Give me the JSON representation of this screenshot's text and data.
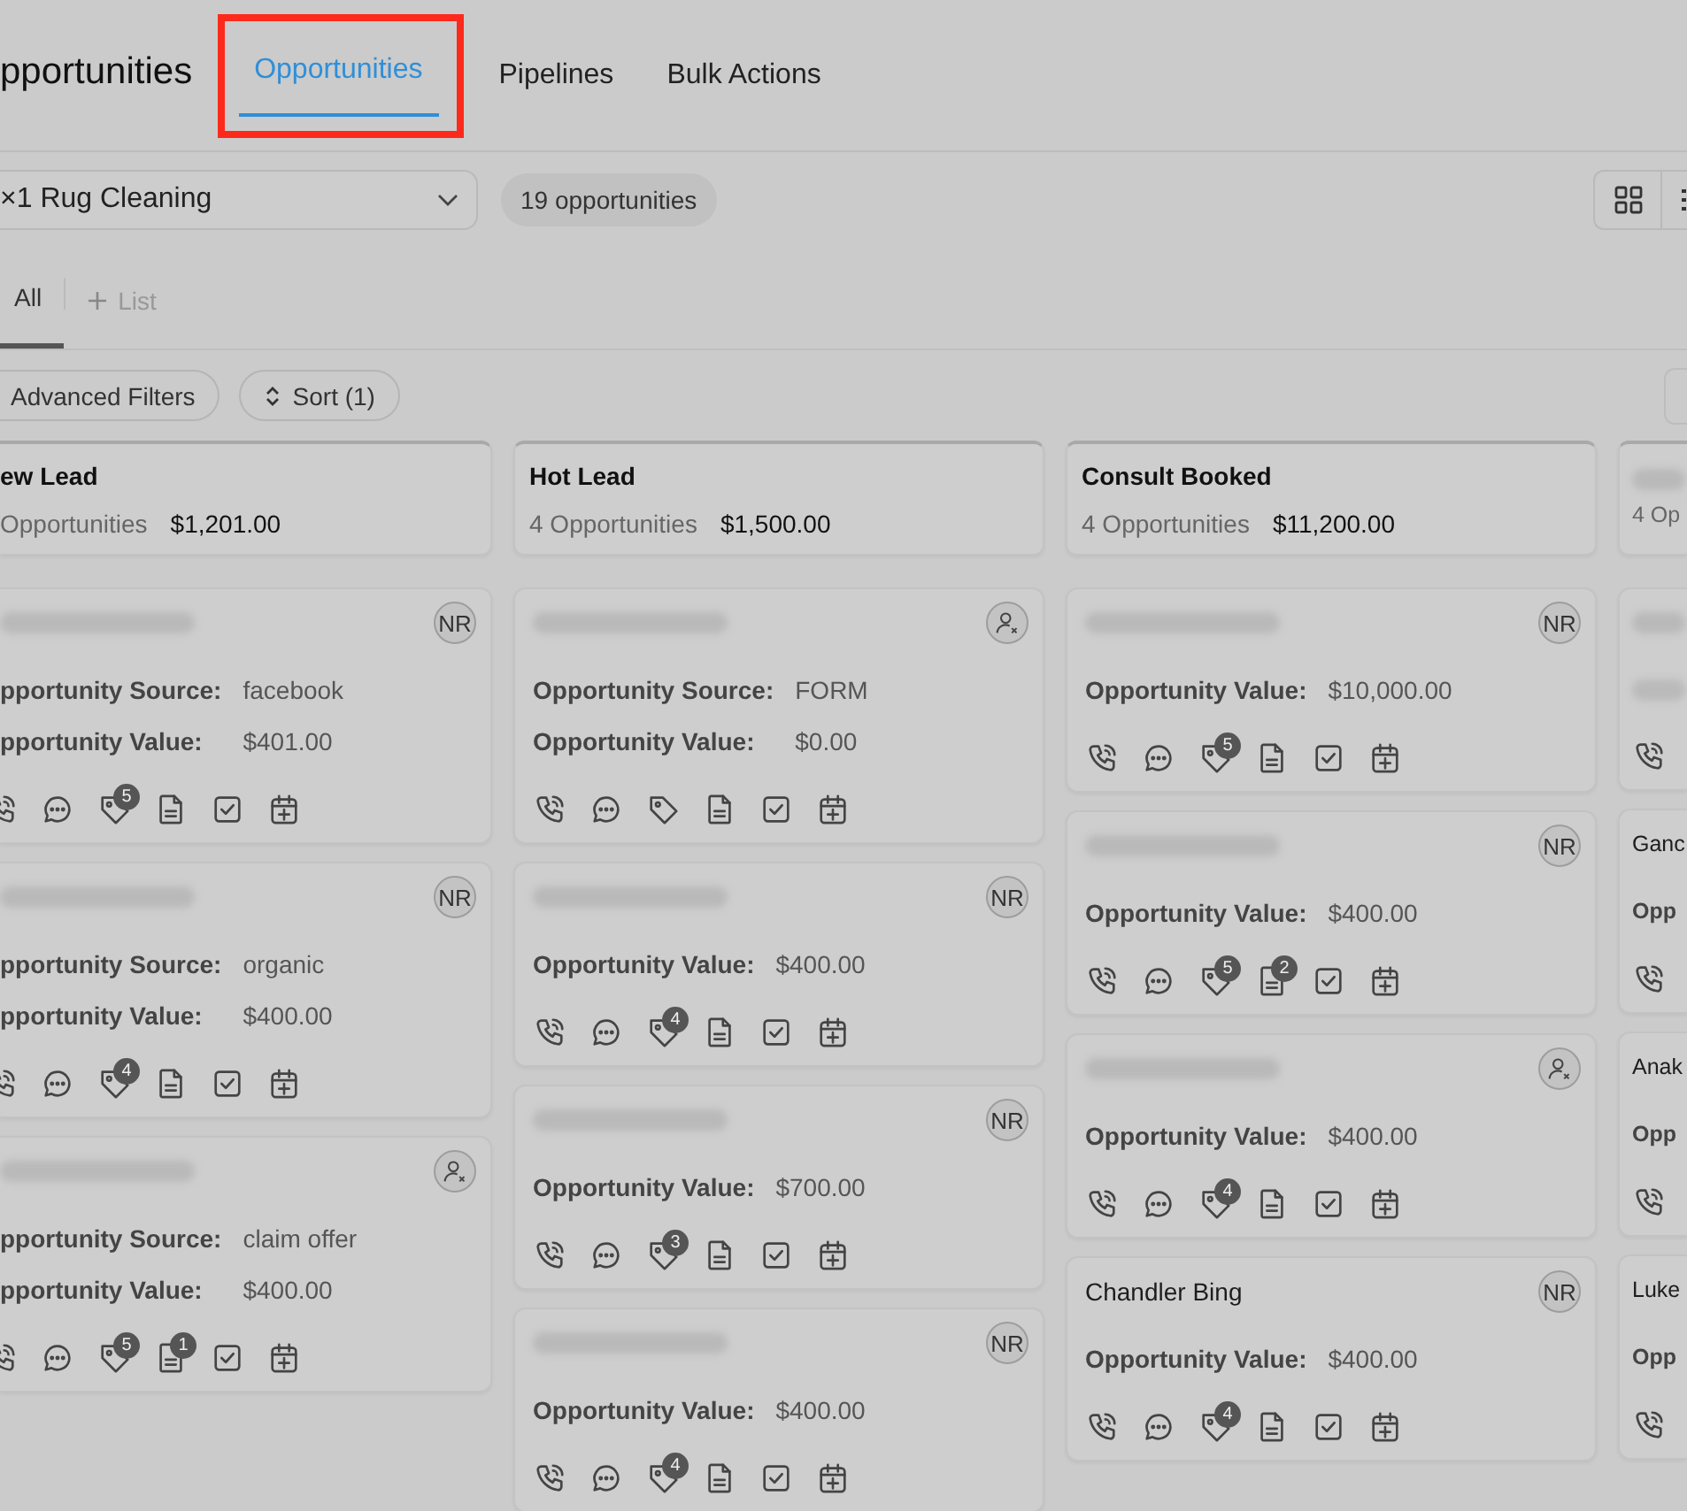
{
  "header": {
    "title": "pportunities",
    "tabs": [
      {
        "label": "Opportunities",
        "selected": true,
        "highlighted": true
      },
      {
        "label": "Pipelines",
        "selected": false,
        "highlighted": false
      },
      {
        "label": "Bulk Actions",
        "selected": false,
        "highlighted": false
      }
    ]
  },
  "toolbar": {
    "pipeline": "×1 Rug Cleaning",
    "count": "19 opportunities",
    "views": [
      {
        "kind": "grid"
      },
      {
        "kind": "list"
      }
    ]
  },
  "list_tabs": [
    {
      "label": "All",
      "kind": "tab",
      "selected": true
    },
    {
      "label": "List",
      "kind": "add",
      "selected": false
    }
  ],
  "filters": [
    {
      "label": "Advanced Filters",
      "kind": "filter"
    },
    {
      "label": "Sort (1)",
      "kind": "sort"
    }
  ],
  "columns": [
    {
      "title": "ew Lead",
      "count": "Opportunities",
      "total": "$1,201.00",
      "cards": [
        {
          "assigned": true,
          "initials": "NR",
          "fields": [
            {
              "label": "pportunity Source:",
              "value": "facebook"
            },
            {
              "label": "pportunity Value:",
              "value": "$401.00"
            }
          ],
          "badges": {
            "tag": "5"
          }
        },
        {
          "assigned": true,
          "initials": "NR",
          "fields": [
            {
              "label": "pportunity Source:",
              "value": "organic"
            },
            {
              "label": "pportunity Value:",
              "value": "$400.00"
            }
          ],
          "badges": {
            "tag": "4"
          }
        },
        {
          "assigned": false,
          "fields": [
            {
              "label": "pportunity Source:",
              "value": "claim offer"
            },
            {
              "label": "pportunity Value:",
              "value": "$400.00"
            }
          ],
          "badges": {
            "tag": "5",
            "note": "1"
          }
        }
      ]
    },
    {
      "title": "Hot Lead",
      "count": "4 Opportunities",
      "total": "$1,500.00",
      "cards": [
        {
          "assigned": false,
          "fields": [
            {
              "label": "Opportunity Source:",
              "value": "FORM"
            },
            {
              "label": "Opportunity Value:",
              "value": "$0.00"
            }
          ]
        },
        {
          "assigned": true,
          "initials": "NR",
          "fields": [
            {
              "label": "Opportunity Value:",
              "value": "$400.00"
            }
          ],
          "badges": {
            "tag": "4"
          }
        },
        {
          "assigned": true,
          "initials": "NR",
          "fields": [
            {
              "label": "Opportunity Value:",
              "value": "$700.00"
            }
          ],
          "badges": {
            "tag": "3"
          }
        },
        {
          "assigned": true,
          "initials": "NR",
          "fields": [
            {
              "label": "Opportunity Value:",
              "value": "$400.00"
            }
          ],
          "badges": {
            "tag": "4"
          }
        }
      ]
    },
    {
      "title": "Consult Booked",
      "count": "4 Opportunities",
      "total": "$11,200.00",
      "cards": [
        {
          "assigned": true,
          "initials": "NR",
          "fields": [
            {
              "label": "Opportunity Value:",
              "value": "$10,000.00"
            }
          ],
          "badges": {
            "tag": "5"
          }
        },
        {
          "assigned": true,
          "initials": "NR",
          "fields": [
            {
              "label": "Opportunity Value:",
              "value": "$400.00"
            }
          ],
          "badges": {
            "tag": "5",
            "note": "2"
          }
        },
        {
          "assigned": false,
          "fields": [
            {
              "label": "Opportunity Value:",
              "value": "$400.00"
            }
          ],
          "badges": {
            "tag": "4"
          }
        },
        {
          "name": "Chandler Bing",
          "assigned": true,
          "initials": "NR",
          "fields": [
            {
              "label": "Opportunity Value:",
              "value": "$400.00"
            }
          ],
          "badges": {
            "tag": "4"
          }
        }
      ]
    },
    {
      "count": "4 Op",
      "cards": [
        {
          "fields": [
            {
              "blurred": true
            }
          ]
        },
        {
          "name": "Ganc",
          "fields": [
            {
              "label": "Opp"
            }
          ]
        },
        {
          "name": "Anak",
          "fields": [
            {
              "label": "Opp"
            }
          ]
        },
        {
          "name": "Luke",
          "fields": [
            {
              "label": "Opp"
            }
          ]
        }
      ]
    }
  ]
}
